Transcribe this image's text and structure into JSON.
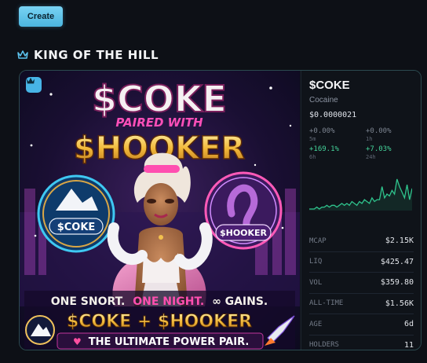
{
  "header": {
    "create_label": "Create"
  },
  "section": {
    "title": "KING OF THE HILL",
    "icon": "crown-icon"
  },
  "card": {
    "art": {
      "title_line1": "$COKE",
      "title_line2": "PAIRED WITH",
      "title_line3": "$HOOKER",
      "badge_left": "$COKE",
      "badge_right": "$HOOKER",
      "slogan_part1": "ONE SNORT.",
      "slogan_part2": "ONE NIGHT.",
      "slogan_part3": "∞ GAINS.",
      "pair_line": "$COKE + $HOOKER",
      "power_line": "THE ULTIMATE POWER PAIR."
    },
    "ticker": "$COKE",
    "name": "Cocaine",
    "price": "$0.0000021",
    "changes": [
      {
        "value": "+0.00%",
        "period": "5m",
        "color": "neutral"
      },
      {
        "value": "+0.00%",
        "period": "1h",
        "color": "neutral"
      },
      {
        "value": "+169.1%",
        "period": "6h",
        "color": "green"
      },
      {
        "value": "+7.03%",
        "period": "24h",
        "color": "green"
      }
    ],
    "sparkline": {
      "color": "#2fc48d",
      "values": [
        8,
        8,
        8,
        9,
        8,
        9,
        9,
        10,
        9,
        10,
        10,
        9,
        10,
        11,
        10,
        11,
        10,
        12,
        11,
        10,
        12,
        11,
        13,
        12,
        11,
        14,
        12,
        13,
        13,
        20,
        14,
        16,
        15,
        18,
        16,
        24,
        20,
        17,
        14,
        21,
        13,
        19
      ]
    },
    "stats": [
      {
        "key": "MCAP",
        "value": "$2.15K"
      },
      {
        "key": "LIQ",
        "value": "$425.47"
      },
      {
        "key": "VOL",
        "value": "$359.80"
      },
      {
        "key": "ALL-TIME",
        "value": "$1.56K"
      },
      {
        "key": "AGE",
        "value": "6d"
      },
      {
        "key": "HOLDERS",
        "value": "11"
      }
    ]
  }
}
